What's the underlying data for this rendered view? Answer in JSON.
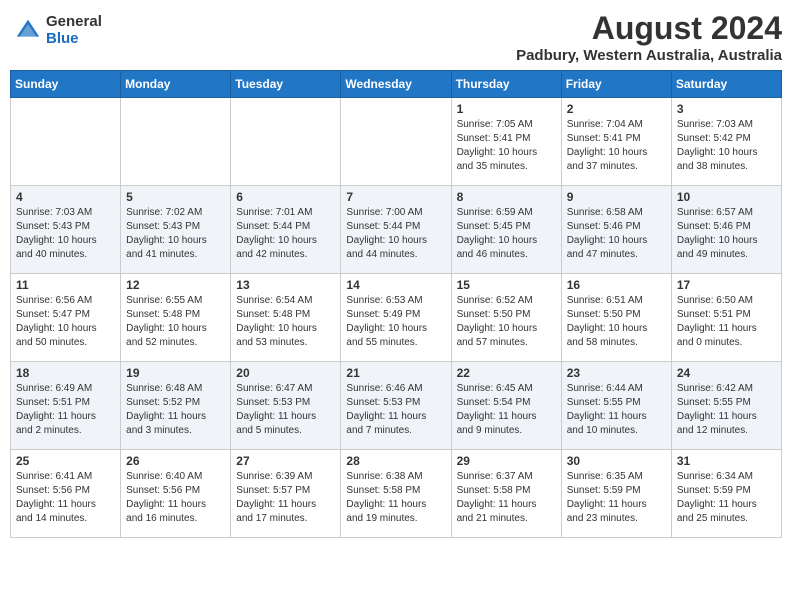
{
  "header": {
    "logo_general": "General",
    "logo_blue": "Blue",
    "month_year": "August 2024",
    "location": "Padbury, Western Australia, Australia"
  },
  "weekdays": [
    "Sunday",
    "Monday",
    "Tuesday",
    "Wednesday",
    "Thursday",
    "Friday",
    "Saturday"
  ],
  "weeks": [
    [
      {
        "day": "",
        "detail": ""
      },
      {
        "day": "",
        "detail": ""
      },
      {
        "day": "",
        "detail": ""
      },
      {
        "day": "",
        "detail": ""
      },
      {
        "day": "1",
        "detail": "Sunrise: 7:05 AM\nSunset: 5:41 PM\nDaylight: 10 hours\nand 35 minutes."
      },
      {
        "day": "2",
        "detail": "Sunrise: 7:04 AM\nSunset: 5:41 PM\nDaylight: 10 hours\nand 37 minutes."
      },
      {
        "day": "3",
        "detail": "Sunrise: 7:03 AM\nSunset: 5:42 PM\nDaylight: 10 hours\nand 38 minutes."
      }
    ],
    [
      {
        "day": "4",
        "detail": "Sunrise: 7:03 AM\nSunset: 5:43 PM\nDaylight: 10 hours\nand 40 minutes."
      },
      {
        "day": "5",
        "detail": "Sunrise: 7:02 AM\nSunset: 5:43 PM\nDaylight: 10 hours\nand 41 minutes."
      },
      {
        "day": "6",
        "detail": "Sunrise: 7:01 AM\nSunset: 5:44 PM\nDaylight: 10 hours\nand 42 minutes."
      },
      {
        "day": "7",
        "detail": "Sunrise: 7:00 AM\nSunset: 5:44 PM\nDaylight: 10 hours\nand 44 minutes."
      },
      {
        "day": "8",
        "detail": "Sunrise: 6:59 AM\nSunset: 5:45 PM\nDaylight: 10 hours\nand 46 minutes."
      },
      {
        "day": "9",
        "detail": "Sunrise: 6:58 AM\nSunset: 5:46 PM\nDaylight: 10 hours\nand 47 minutes."
      },
      {
        "day": "10",
        "detail": "Sunrise: 6:57 AM\nSunset: 5:46 PM\nDaylight: 10 hours\nand 49 minutes."
      }
    ],
    [
      {
        "day": "11",
        "detail": "Sunrise: 6:56 AM\nSunset: 5:47 PM\nDaylight: 10 hours\nand 50 minutes."
      },
      {
        "day": "12",
        "detail": "Sunrise: 6:55 AM\nSunset: 5:48 PM\nDaylight: 10 hours\nand 52 minutes."
      },
      {
        "day": "13",
        "detail": "Sunrise: 6:54 AM\nSunset: 5:48 PM\nDaylight: 10 hours\nand 53 minutes."
      },
      {
        "day": "14",
        "detail": "Sunrise: 6:53 AM\nSunset: 5:49 PM\nDaylight: 10 hours\nand 55 minutes."
      },
      {
        "day": "15",
        "detail": "Sunrise: 6:52 AM\nSunset: 5:50 PM\nDaylight: 10 hours\nand 57 minutes."
      },
      {
        "day": "16",
        "detail": "Sunrise: 6:51 AM\nSunset: 5:50 PM\nDaylight: 10 hours\nand 58 minutes."
      },
      {
        "day": "17",
        "detail": "Sunrise: 6:50 AM\nSunset: 5:51 PM\nDaylight: 11 hours\nand 0 minutes."
      }
    ],
    [
      {
        "day": "18",
        "detail": "Sunrise: 6:49 AM\nSunset: 5:51 PM\nDaylight: 11 hours\nand 2 minutes."
      },
      {
        "day": "19",
        "detail": "Sunrise: 6:48 AM\nSunset: 5:52 PM\nDaylight: 11 hours\nand 3 minutes."
      },
      {
        "day": "20",
        "detail": "Sunrise: 6:47 AM\nSunset: 5:53 PM\nDaylight: 11 hours\nand 5 minutes."
      },
      {
        "day": "21",
        "detail": "Sunrise: 6:46 AM\nSunset: 5:53 PM\nDaylight: 11 hours\nand 7 minutes."
      },
      {
        "day": "22",
        "detail": "Sunrise: 6:45 AM\nSunset: 5:54 PM\nDaylight: 11 hours\nand 9 minutes."
      },
      {
        "day": "23",
        "detail": "Sunrise: 6:44 AM\nSunset: 5:55 PM\nDaylight: 11 hours\nand 10 minutes."
      },
      {
        "day": "24",
        "detail": "Sunrise: 6:42 AM\nSunset: 5:55 PM\nDaylight: 11 hours\nand 12 minutes."
      }
    ],
    [
      {
        "day": "25",
        "detail": "Sunrise: 6:41 AM\nSunset: 5:56 PM\nDaylight: 11 hours\nand 14 minutes."
      },
      {
        "day": "26",
        "detail": "Sunrise: 6:40 AM\nSunset: 5:56 PM\nDaylight: 11 hours\nand 16 minutes."
      },
      {
        "day": "27",
        "detail": "Sunrise: 6:39 AM\nSunset: 5:57 PM\nDaylight: 11 hours\nand 17 minutes."
      },
      {
        "day": "28",
        "detail": "Sunrise: 6:38 AM\nSunset: 5:58 PM\nDaylight: 11 hours\nand 19 minutes."
      },
      {
        "day": "29",
        "detail": "Sunrise: 6:37 AM\nSunset: 5:58 PM\nDaylight: 11 hours\nand 21 minutes."
      },
      {
        "day": "30",
        "detail": "Sunrise: 6:35 AM\nSunset: 5:59 PM\nDaylight: 11 hours\nand 23 minutes."
      },
      {
        "day": "31",
        "detail": "Sunrise: 6:34 AM\nSunset: 5:59 PM\nDaylight: 11 hours\nand 25 minutes."
      }
    ]
  ]
}
